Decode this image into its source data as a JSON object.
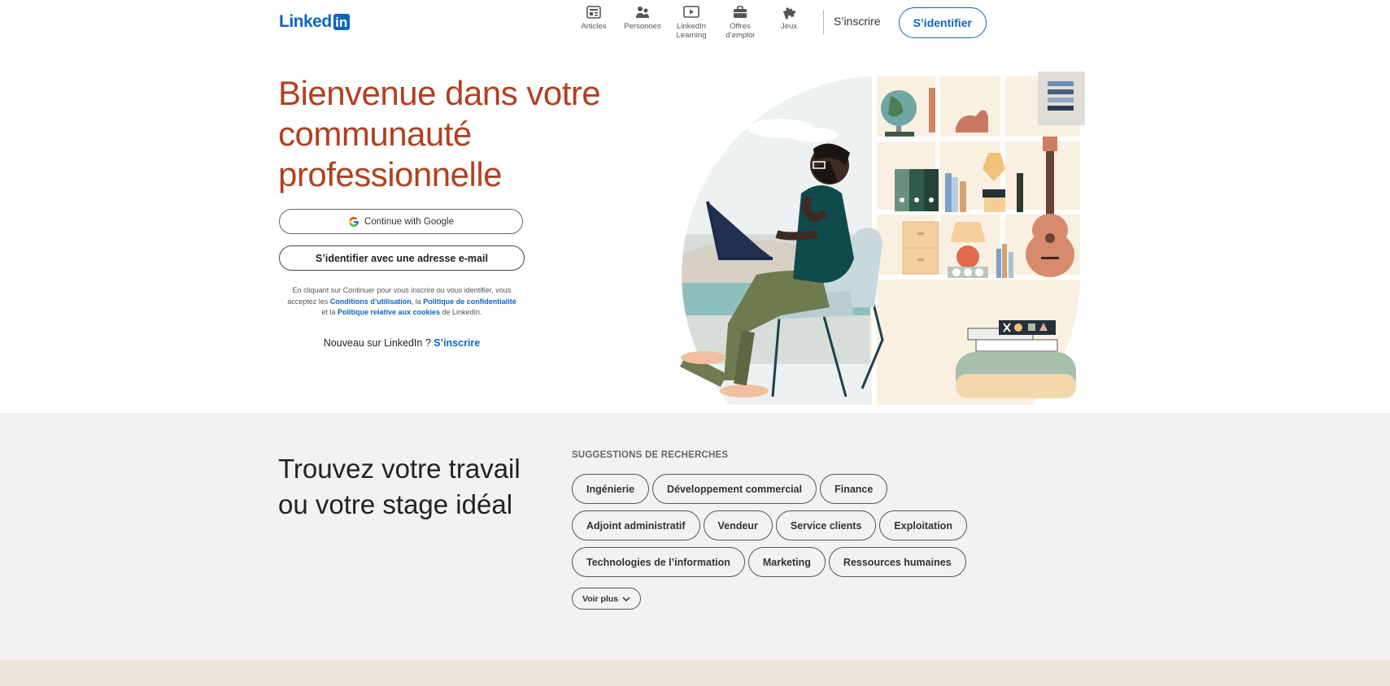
{
  "nav": {
    "logo_text": "Linked",
    "logo_in": "in",
    "items": [
      {
        "label": "Articles",
        "icon": "articles-icon"
      },
      {
        "label": "Personnes",
        "icon": "people-icon"
      },
      {
        "label": "LinkedIn Learning",
        "icon": "learning-icon"
      },
      {
        "label": "Offres d’emploi",
        "icon": "briefcase-icon"
      },
      {
        "label": "Jeux",
        "icon": "puzzle-icon"
      }
    ],
    "signup_label": "S’inscrire",
    "signin_label": "S’identifier"
  },
  "hero": {
    "title": "Bienvenue dans votre communauté professionnelle",
    "google_button": "Continue with Google",
    "email_button": "S’identifier avec une adresse e-mail",
    "legal": {
      "part1": "En cliquant sur Continuer pour vous inscrire ou vous identifier, vous acceptez les ",
      "terms_link": "Conditions d’utilisation",
      "part2": ", la ",
      "privacy_link": "Politique de confidentialité",
      "part3": " et la ",
      "cookies_link": "Politique relative aux cookies",
      "part4": " de LinkedIn."
    },
    "new_user_text": "Nouveau sur LinkedIn ? ",
    "new_user_link": "S’inscrire"
  },
  "jobs": {
    "title": "Trouvez votre travail ou votre stage idéal",
    "suggestions_heading": "SUGGESTIONS DE RECHERCHES",
    "rows": [
      [
        "Ingénierie",
        "Développement commercial",
        "Finance"
      ],
      [
        "Adjoint administratif",
        "Vendeur",
        "Service clients",
        "Exploitation"
      ],
      [
        "Technologies de l’information",
        "Marketing",
        "Ressources humaines"
      ]
    ],
    "more_label": "Voir plus"
  },
  "colors": {
    "brand": "#0a66c2",
    "hero_title": "#b24020",
    "section_bg": "#f3f2f0"
  }
}
